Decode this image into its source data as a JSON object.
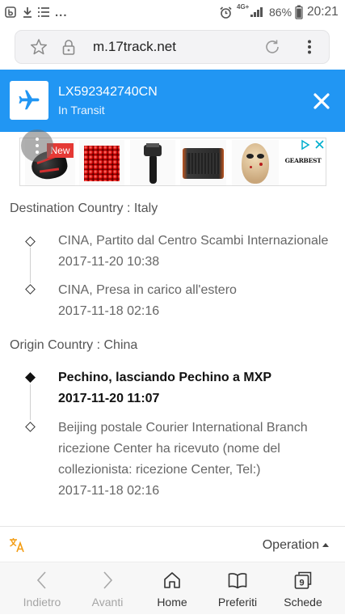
{
  "theme": {
    "accent": "#2196F3",
    "ad_badge": "#E53935",
    "translate_icon": "#F39C12"
  },
  "status_bar": {
    "more": "...",
    "network": "4G+",
    "battery": "86%",
    "time": "20:21"
  },
  "browser": {
    "url": "m.17track.net"
  },
  "header": {
    "tracking_number": "LX592342740CN",
    "status": "In Transit",
    "icon": "airplane-icon"
  },
  "ad": {
    "badge": "New",
    "brand": "GEARBEST"
  },
  "tracking": {
    "destination": {
      "heading": "Destination Country : Italy",
      "events": [
        {
          "description": "CINA, Partito dal Centro Scambi Internazionale",
          "time": "2017-11-20 10:38"
        },
        {
          "description": "CINA, Presa in carico all'estero",
          "time": "2017-11-18 02:16"
        }
      ]
    },
    "origin": {
      "heading": "Origin Country : China",
      "events": [
        {
          "description": "Pechino, lasciando Pechino a MXP",
          "time": "2017-11-20 11:07"
        },
        {
          "description": "Beijing postale Courier International Branch ricezione Center ha ricevuto (nome del collezionista: ricezione Center, Tel:)",
          "time": "2017-11-18 02:16"
        }
      ]
    }
  },
  "footer": {
    "operation_label": "Operation"
  },
  "nav": {
    "back": "Indietro",
    "forward": "Avanti",
    "home": "Home",
    "bookmarks": "Preferiti",
    "tabs": "Schede",
    "tab_count": "9"
  }
}
